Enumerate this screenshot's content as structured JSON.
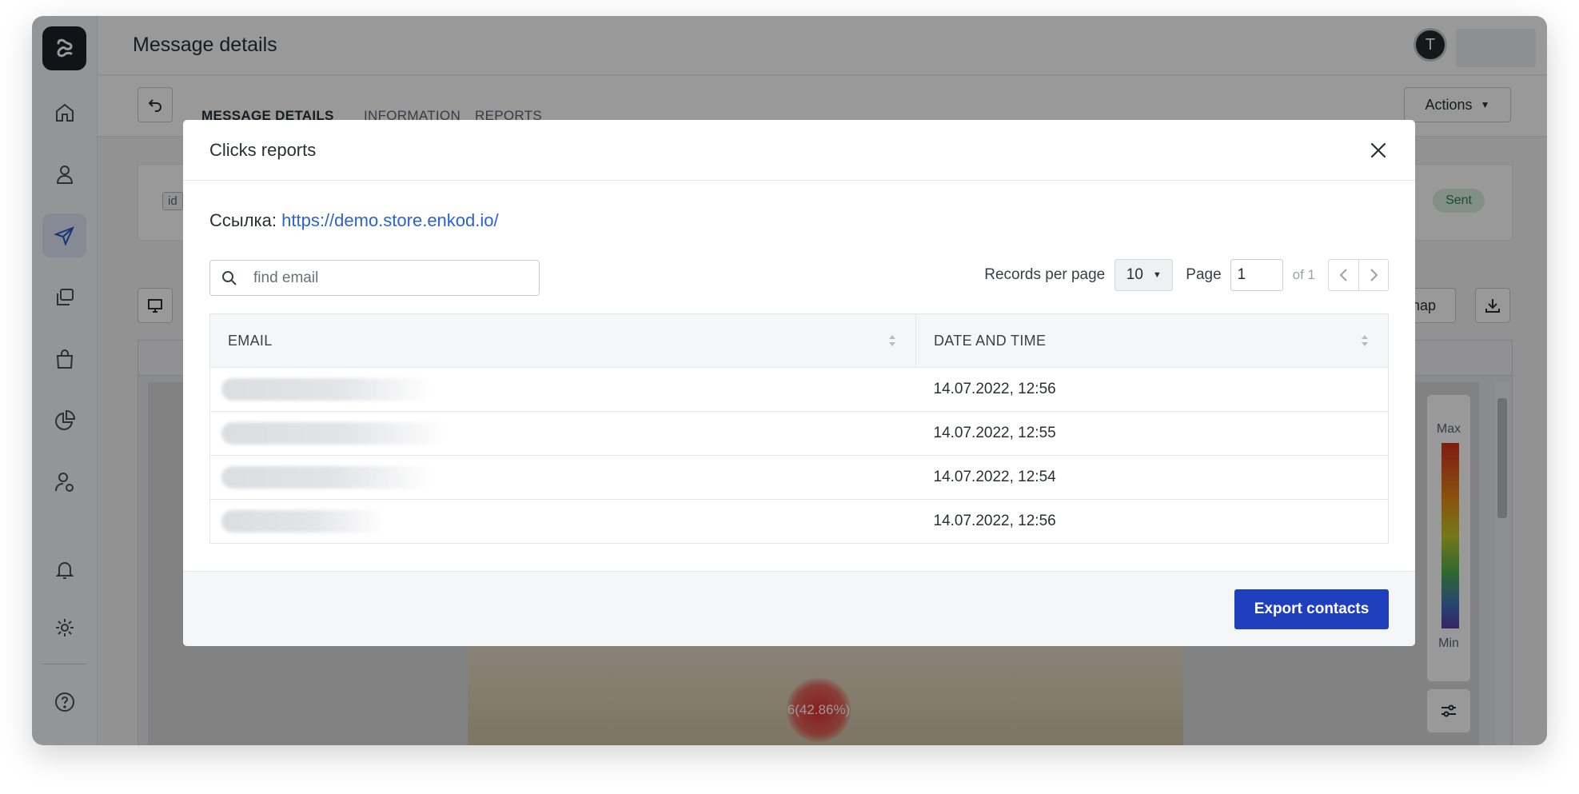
{
  "header": {
    "title": "Message details",
    "avatar_initial": "T"
  },
  "subheader": {
    "tabs": [
      {
        "label": "MESSAGE DETAILS",
        "active": true
      },
      {
        "label": "INFORMATION",
        "active": false
      },
      {
        "label": "REPORTS",
        "active": false
      }
    ],
    "actions_label": "Actions"
  },
  "details": {
    "id_tag": "id",
    "status": "Sent"
  },
  "toolbar": {
    "heatmap_label": "map"
  },
  "heatmap": {
    "hotspot_label": "6(42.86%)",
    "legend_max": "Max",
    "legend_min": "Min"
  },
  "sidebar": {
    "items": [
      "home-icon",
      "user-icon",
      "send-icon",
      "copy-icon",
      "bag-icon",
      "pie-chart-icon",
      "user-settings-icon",
      "bell-icon",
      "gear-icon",
      "help-icon"
    ],
    "active": "send-icon"
  },
  "modal": {
    "title": "Clicks reports",
    "link_label": "Ссылка:",
    "link_url": "https://demo.store.enkod.io/",
    "search_placeholder": "find email",
    "records_per_page_label": "Records per page",
    "records_per_page_value": "10",
    "page_label": "Page",
    "page_value": "1",
    "page_of": "of 1",
    "columns": [
      "EMAIL",
      "DATE AND TIME"
    ],
    "rows": [
      {
        "email": "",
        "datetime": "14.07.2022, 12:56"
      },
      {
        "email": "",
        "datetime": "14.07.2022, 12:55"
      },
      {
        "email": "",
        "datetime": "14.07.2022, 12:54"
      },
      {
        "email": "",
        "datetime": "14.07.2022, 12:56"
      }
    ],
    "export_label": "Export contacts"
  },
  "colors": {
    "accent": "#1f3fbf",
    "link": "#2a62d6",
    "active_nav": "#dfe7f8"
  }
}
